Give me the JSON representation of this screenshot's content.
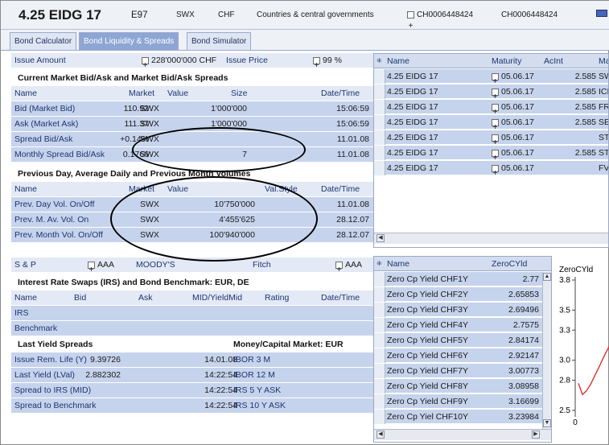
{
  "header": {
    "symbol": "4.25 EIDG 17",
    "code": "E97",
    "exchange": "SWX",
    "currency": "CHF",
    "category": "Countries & central governments",
    "isin_box": "CH0006448424",
    "isin": "CH0006448424"
  },
  "tabs": [
    "Bond Calculator",
    "Bond Liquidity & Spreads",
    "Bond Simulator"
  ],
  "active_tab": 1,
  "issue": {
    "amount_label": "Issue Amount",
    "amount_value": "228'000'000 CHF",
    "price_label": "Issue Price",
    "price_value": "99 %"
  },
  "bidask": {
    "title": "Current Market Bid/Ask and Market Bid/Ask Spreads",
    "cols": [
      "Name",
      "Market",
      "Value",
      "Size",
      "Date/Time"
    ],
    "rows": [
      [
        "Bid (Market Bid)",
        "SWX",
        "110.92",
        "1'000'000",
        "15:06:59"
      ],
      [
        "Ask (Market Ask)",
        "SWX",
        "111.37",
        "1'000'000",
        "15:06:59"
      ],
      [
        "Spread Bid/Ask",
        "SWX",
        "+0.14%",
        "",
        "11.01.08"
      ],
      [
        "Monthly Spread Bid/Ask",
        "SWX",
        "0.1766",
        "7",
        "11.01.08"
      ]
    ]
  },
  "volumes": {
    "title": "Previous Day, Average Daily and Previous Month Volumes",
    "cols": [
      "Name",
      "Market",
      "Value",
      "Val.Style",
      "Date/Time"
    ],
    "rows": [
      [
        "Prev. Day Vol. On/Off",
        "SWX",
        "10'750'000",
        "11.01.08"
      ],
      [
        "Prev. M. Av. Vol. On",
        "SWX",
        "4'455'625",
        "28.12.07"
      ],
      [
        "Prev. Month Vol. On/Off",
        "SWX",
        "100'940'000",
        "28.12.07"
      ]
    ]
  },
  "ratings": {
    "sp_label": "S & P",
    "sp_value": "AAA",
    "moodys_label": "MOODY'S",
    "fitch_label": "Fitch",
    "fitch_value": "AAA"
  },
  "irs": {
    "title": "Interest Rate Swaps (IRS) and Bond Benchmark: EUR, DE",
    "cols": [
      "Name",
      "Bid",
      "Ask",
      "MID/YieldMid",
      "Rating",
      "Date/Time"
    ],
    "rows": [
      "IRS",
      "Benchmark"
    ]
  },
  "yield": {
    "title": "Last Yield Spreads",
    "mm_title": "Money/Capital Market: EUR",
    "rows": [
      [
        "Issue Rem. Life (Y)",
        "9.39726",
        "14.01.08",
        "IBOR 3 M"
      ],
      [
        "Last Yield (LVal)",
        "2.882302",
        "14:22:54",
        "IBOR 12 M"
      ],
      [
        "Spread to IRS (MID)",
        "",
        "14:22:54",
        "IRS 5 Y ASK"
      ],
      [
        "Spread to Benchmark",
        "",
        "14:22:54",
        "IRS 10 Y ASK"
      ]
    ]
  },
  "market_list": {
    "cols": [
      "Name",
      "Maturity",
      "AcInt",
      "Ma"
    ],
    "rows": [
      [
        "4.25 EIDG 17",
        "05.06.17",
        "2.585",
        "SW"
      ],
      [
        "4.25 EIDG 17",
        "05.06.17",
        "2.585",
        "ICI"
      ],
      [
        "4.25 EIDG 17",
        "05.06.17",
        "2.585",
        "FR"
      ],
      [
        "4.25 EIDG 17",
        "05.06.17",
        "2.585",
        "SE"
      ],
      [
        "4.25 EIDG 17",
        "05.06.17",
        "",
        "ST"
      ],
      [
        "4.25 EIDG 17",
        "05.06.17",
        "2.585",
        "ST"
      ],
      [
        "4.25 EIDG 17",
        "05.06.17",
        "",
        "FV"
      ]
    ]
  },
  "zero_list": {
    "cols": [
      "Name",
      "ZeroCYld"
    ],
    "rows": [
      [
        "Zero Cp Yield CHF1Y",
        "2.77"
      ],
      [
        "Zero Cp Yield CHF2Y",
        "2.65853"
      ],
      [
        "Zero Cp Yield CHF3Y",
        "2.69496"
      ],
      [
        "Zero Cp Yield CHF4Y",
        "2.7575"
      ],
      [
        "Zero Cp Yield CHF5Y",
        "2.84174"
      ],
      [
        "Zero Cp Yield CHF6Y",
        "2.92147"
      ],
      [
        "Zero Cp Yield CHF7Y",
        "3.00773"
      ],
      [
        "Zero Cp Yield CHF8Y",
        "3.08958"
      ],
      [
        "Zero Cp Yield CHF9Y",
        "3.16699"
      ],
      [
        "Zero Cp Yiel CHF10Y",
        "3.23984"
      ]
    ]
  },
  "mini_chart": {
    "title": "ZeroCYld",
    "y_ticks": [
      "3.8",
      "3.5",
      "3.3",
      "3.0",
      "2.8",
      "2.5"
    ],
    "x_tick": "0",
    "line_color": "#e03030"
  }
}
